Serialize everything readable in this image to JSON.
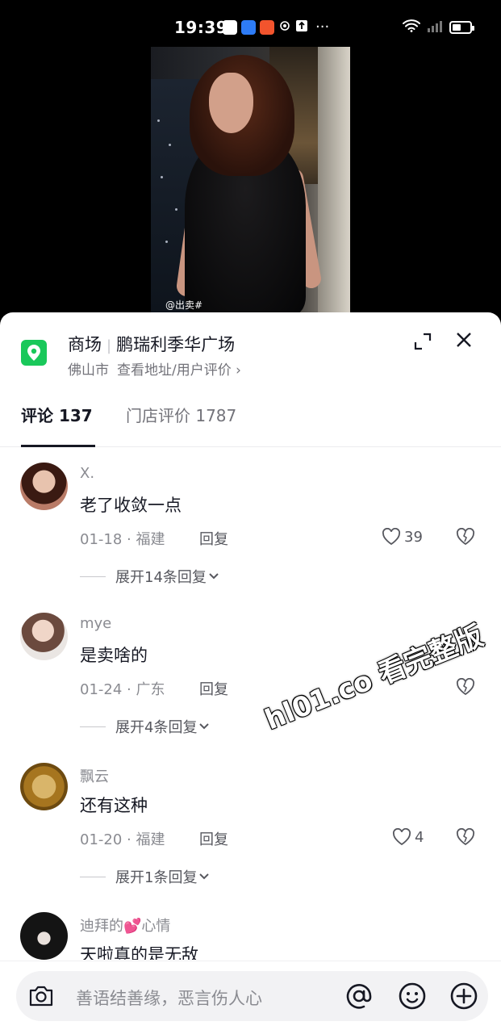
{
  "status_bar": {
    "time": "19:39",
    "more": "···"
  },
  "video": {
    "watermark": "@出卖#"
  },
  "location": {
    "category": "商场",
    "name": "鹏瑞利季华广场",
    "city": "佛山市",
    "link": "查看地址/用户评价 ›"
  },
  "tabs": {
    "comments": "评论 137",
    "reviews": "门店评价 1787"
  },
  "comments": [
    {
      "user": "X.",
      "text": "老了收敛一点",
      "meta": "01-18 · 福建",
      "reply": "回复",
      "likes": "39",
      "expand": "展开14条回复"
    },
    {
      "user": "mye",
      "text": "是卖啥的",
      "meta": "01-24 · 广东",
      "reply": "回复",
      "likes": "",
      "expand": "展开4条回复"
    },
    {
      "user": "飘云",
      "text": "还有这种",
      "meta": "01-20 · 福建",
      "reply": "回复",
      "likes": "4",
      "expand": "展开1条回复"
    },
    {
      "user": "迪拜的💕心情",
      "text": "天啦真的是无敌"
    }
  ],
  "overlay_watermark": "hl01.co 看完整版",
  "input": {
    "placeholder": "善语结善缘，恶言伤人心"
  },
  "colors": {
    "location_green": "#19c85a",
    "text_primary": "#161823",
    "text_secondary": "#8a8b91"
  }
}
